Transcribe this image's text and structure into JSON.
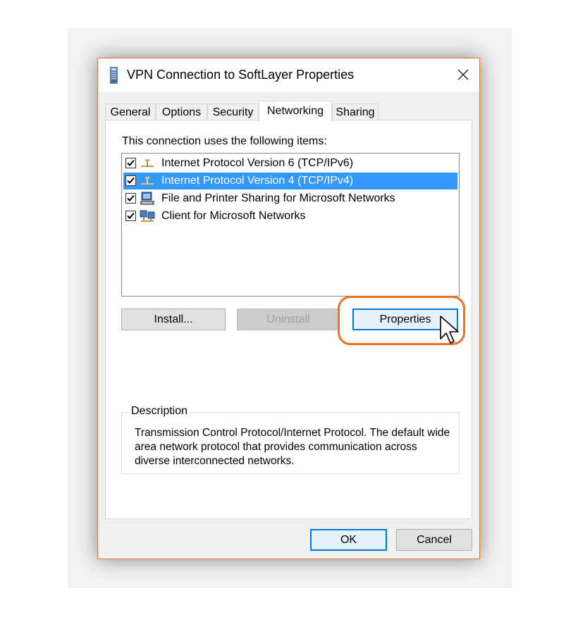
{
  "window": {
    "title": "VPN Connection to SoftLayer Properties",
    "icon": "vpn-phone-icon"
  },
  "tabs": [
    {
      "label": "General",
      "active": false
    },
    {
      "label": "Options",
      "active": false
    },
    {
      "label": "Security",
      "active": false
    },
    {
      "label": "Networking",
      "active": true
    },
    {
      "label": "Sharing",
      "active": false
    }
  ],
  "networking": {
    "items_label": "This connection uses the following items:",
    "items": [
      {
        "label": "Internet Protocol Version 6 (TCP/IPv6)",
        "checked": true,
        "selected": false,
        "icon": "network-protocol-icon"
      },
      {
        "label": "Internet Protocol Version 4 (TCP/IPv4)",
        "checked": true,
        "selected": true,
        "icon": "network-protocol-icon"
      },
      {
        "label": "File and Printer Sharing for Microsoft Networks",
        "checked": true,
        "selected": false,
        "icon": "file-printer-sharing-icon"
      },
      {
        "label": "Client for Microsoft Networks",
        "checked": true,
        "selected": false,
        "icon": "network-client-icon"
      }
    ],
    "install_label": "Install...",
    "uninstall_label": "Uninstall",
    "properties_label": "Properties",
    "description": {
      "legend": "Description",
      "text": "Transmission Control Protocol/Internet Protocol. The default wide area network protocol that provides communication across diverse interconnected networks."
    }
  },
  "footer": {
    "ok_label": "OK",
    "cancel_label": "Cancel"
  },
  "colors": {
    "selection": "#3399ff",
    "focus_border": "#0078d7",
    "highlight_ring": "#f07020",
    "window_border": "#e07b3a"
  }
}
